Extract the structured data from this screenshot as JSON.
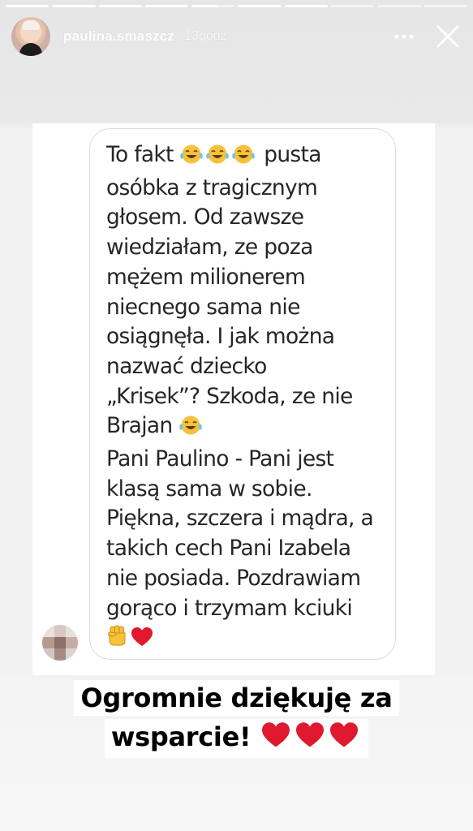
{
  "story": {
    "progress": [
      1,
      1,
      1,
      1,
      0.6,
      1,
      1,
      0,
      0,
      0
    ]
  },
  "header": {
    "username": "paulina.smaszcz",
    "time_ago": "13godz.",
    "more_icon": "more-horizontal-icon",
    "close_icon": "close-icon"
  },
  "message": {
    "lines": [
      "To fakt",
      "pusta",
      "osóbka z tragicznym",
      "głosem. Od zawsze",
      "wiedziałam, ze poza",
      "mężem milionerem",
      "niecnego sama nie",
      "osiągnęła. I jak można",
      "nazwać dziecko",
      "„Krisek”? Szkoda, ze nie",
      "Brajan",
      "Pani Paulino - Pani jest",
      "klasą sama w sobie.",
      "Piękna, szczera i mądra, a",
      "takich cech Pani Izabela",
      "nie posiada. Pozdrawiam",
      "gorąco i trzymam kciuki"
    ],
    "emojis": [
      "face-with-tears-of-joy",
      "raised-fist",
      "red-heart"
    ]
  },
  "caption": {
    "line1": "Ogromnie dziękuję za",
    "line2": "wsparcie!"
  },
  "colors": {
    "heart": "#e0192e",
    "emoji_yellow": "#f6c23a",
    "text": "#262626"
  }
}
